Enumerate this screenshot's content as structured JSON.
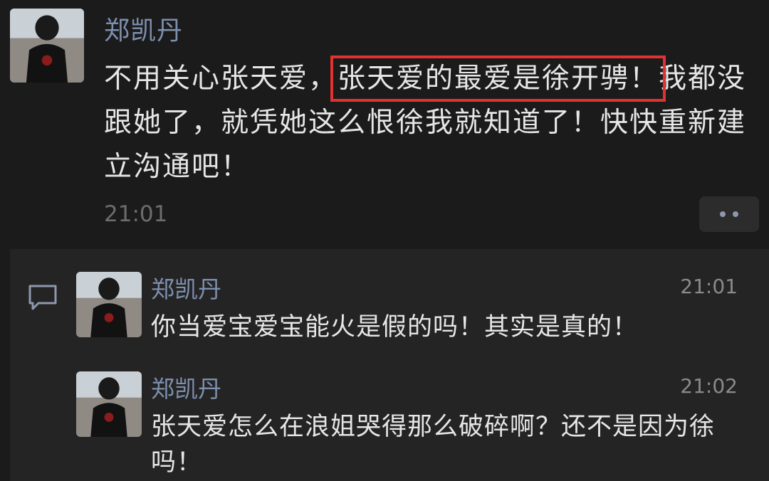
{
  "post": {
    "author": "郑凯丹",
    "text_before": "不用关心张天爱，",
    "text_highlight": "张天爱的最爱是徐开骋！",
    "text_after": "我都没跟她了，就凭她这么恨徐我就知道了！快快重新建立沟通吧！",
    "time": "21:01",
    "more_icon": "more-dots-icon"
  },
  "comments": [
    {
      "author": "郑凯丹",
      "time": "21:01",
      "text": "你当爱宝爱宝能火是假的吗！其实是真的！"
    },
    {
      "author": "郑凯丹",
      "time": "21:02",
      "text": "张天爱怎么在浪姐哭得那么破碎啊？还不是因为徐吗！"
    }
  ],
  "colors": {
    "background": "#1b1b1b",
    "comment_area": "#242424",
    "name": "#7d8fae",
    "highlight_border": "#e0322f",
    "text": "#e6e6e6"
  }
}
